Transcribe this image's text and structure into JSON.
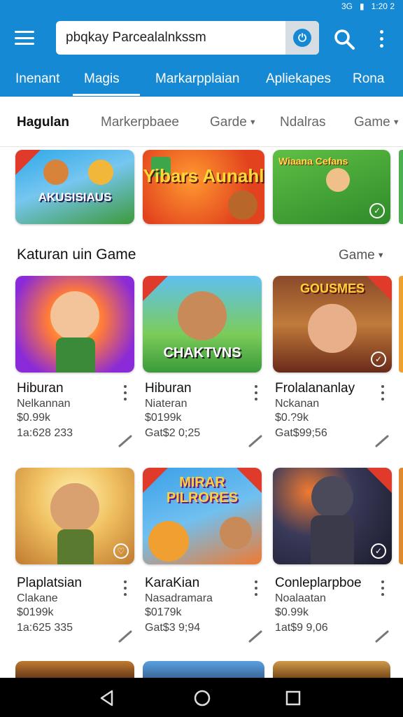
{
  "status": {
    "time": "1:20 2",
    "signal_text": "3G"
  },
  "search": {
    "value": "pbqkay Parcealalnkssm"
  },
  "tabs": [
    {
      "label": "Inenant"
    },
    {
      "label": "Magis"
    },
    {
      "label": "Markarpplaian"
    },
    {
      "label": "Apliekapes"
    },
    {
      "label": "Rona"
    }
  ],
  "chips": [
    {
      "label": "Hagulan"
    },
    {
      "label": "Markerpbaee"
    },
    {
      "label": "Garde"
    },
    {
      "label": "Ndalras"
    },
    {
      "label": "Game"
    }
  ],
  "banners": [
    {
      "text": "AKUSISIAUS"
    },
    {
      "text": "Yibars Aunahl"
    },
    {
      "text": "Wiaana Cefans"
    }
  ],
  "section": {
    "title": "Katuran uin Game",
    "sort_label": "Game"
  },
  "cards": [
    {
      "art_text": "",
      "title": "Hiburan",
      "subtitle": "Nelkannan",
      "price": "$0.99k",
      "meta": "1a:628 233"
    },
    {
      "art_text": "CHAKTVNS",
      "title": "Hiburan",
      "subtitle": "Niateran",
      "price": "$0199k",
      "meta": "Gat$2 0;25"
    },
    {
      "art_text": "GOUSMES",
      "title": "Frolalananlay",
      "subtitle": "Nckanan",
      "price": "$0.?9k",
      "meta": "Gat$99;56"
    },
    {
      "art_text": "",
      "title": "Plaplatsian",
      "subtitle": "Clakane",
      "price": "$0199k",
      "meta": "1a:625 335"
    },
    {
      "art_text": "MIRAR PILRORES",
      "title": "KaraKian",
      "subtitle": "Nasadramara",
      "price": "$0179k",
      "meta": "Gat$3 9;94"
    },
    {
      "art_text": "",
      "title": "Conleplarpboe",
      "subtitle": "Noalaatan",
      "price": "$0.99k",
      "meta": "1at$9 9,06"
    }
  ]
}
